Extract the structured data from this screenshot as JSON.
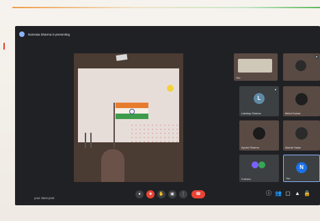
{
  "presenting": {
    "text": "Namrata Sharma is presenting"
  },
  "shared_screen": {
    "description_icons": [
      "flag-drawing",
      "sun-drawing",
      "soldier-drawing",
      "pole-drawing"
    ]
  },
  "participants": [
    {
      "name": "You",
      "type": "camera"
    },
    {
      "name": "Lakshay Sharma",
      "type": "avatar",
      "initial": "L",
      "color": "#5f8aa6"
    },
    {
      "name": "Mehul Kumar",
      "type": "camera"
    },
    {
      "name": "Ayushi Sharma",
      "type": "camera"
    },
    {
      "name": "Akshat Yadav",
      "type": "camera"
    },
    {
      "name": "Aarav",
      "type": "camera"
    },
    {
      "name": "3 others",
      "type": "avatars"
    },
    {
      "name": "You",
      "type": "avatar",
      "initial": "N",
      "color": "#1a73e8"
    }
  ],
  "self_view": {
    "name": "Hemant Bhatnagar"
  },
  "bottom_left": {
    "text": "your class post"
  },
  "controls": {
    "mic": "mic-icon",
    "cam": "camera-icon",
    "raise": "hand-icon",
    "present": "present-icon",
    "more": "more-icon",
    "leave": "end-call-icon"
  },
  "right_controls": [
    "info-icon",
    "people-icon",
    "chat-icon",
    "activities-icon",
    "lock-icon"
  ],
  "colors": {
    "meet_bg": "#202124",
    "leave": "#ea4335",
    "accent": "#8ab4f8"
  }
}
